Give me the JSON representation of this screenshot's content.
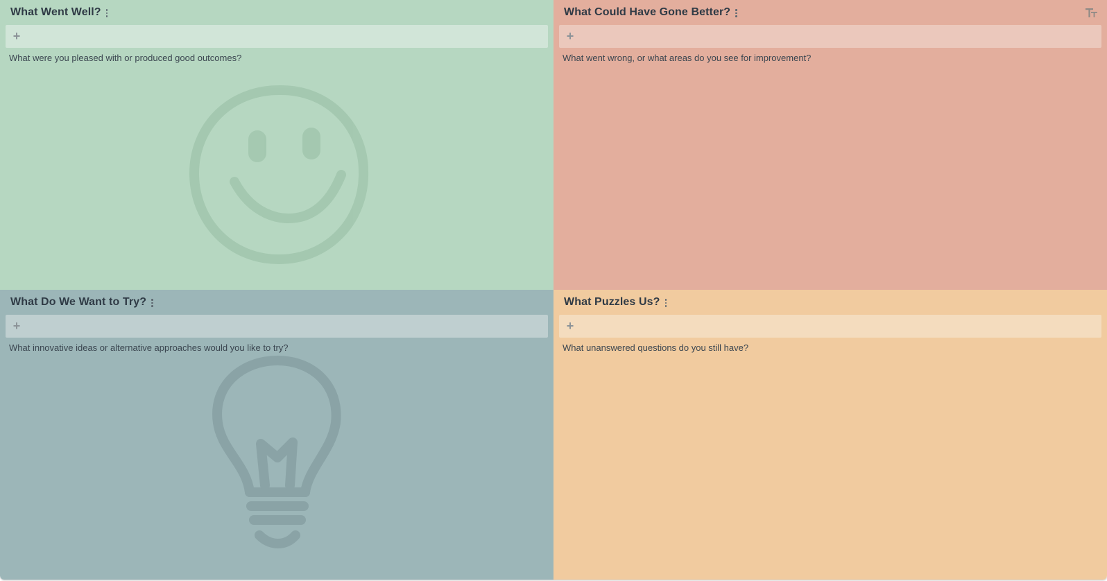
{
  "quadrants": [
    {
      "title": "What Went Well?",
      "prompt": "What were you pleased with or produced good outcomes?",
      "add_symbol": "+",
      "icon": "smiley-face-icon",
      "bg_color": "#b6d7c1",
      "input_color": "#d1e5d8",
      "icon_color": "#9fc4ab"
    },
    {
      "title": "What Could Have Gone Better?",
      "prompt": "What went wrong, or what areas do you see for improvement?",
      "add_symbol": "+",
      "icon": "sad-face-icon",
      "bg_color": "#e3ae9d",
      "input_color": "#ebc8bc",
      "icon_color": "#d49f8f"
    },
    {
      "title": "What Do We Want to Try?",
      "prompt": "What innovative ideas or alternative approaches would you like to try?",
      "add_symbol": "+",
      "icon": "lightbulb-icon",
      "bg_color": "#9cb6b8",
      "input_color": "#bfcfd0",
      "icon_color": "#8aa3a6"
    },
    {
      "title": "What Puzzles Us?",
      "prompt": "What unanswered questions do you still have?",
      "add_symbol": "+",
      "icon": "puzzle-piece-icon",
      "bg_color": "#f1cb9f",
      "input_color": "#f4dcbe",
      "icon_color": "#e6bd8f"
    }
  ],
  "toolbar": {
    "text_size_icon": "text-size-icon"
  }
}
